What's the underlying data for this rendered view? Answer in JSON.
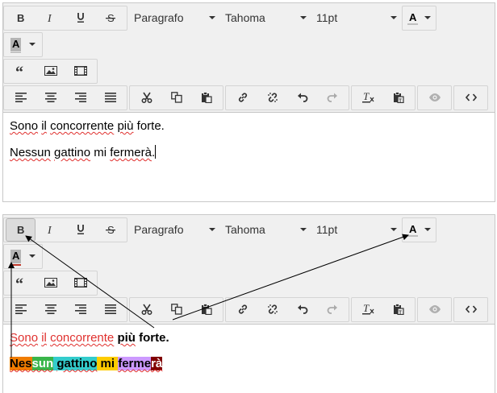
{
  "toolbar": {
    "paragraph_select": "Paragrafo",
    "font_select": "Tahoma",
    "size_select": "11pt",
    "text_color_letter": "A",
    "bg_color_letter": "A"
  },
  "editor1": {
    "line1": [
      {
        "text": "Sono",
        "sq": true
      },
      {
        "text": " "
      },
      {
        "text": "il",
        "sq": true
      },
      {
        "text": " "
      },
      {
        "text": "concorrente",
        "sq": true
      },
      {
        "text": " "
      },
      {
        "text": "più",
        "sq": true
      },
      {
        "text": " forte."
      }
    ],
    "line2": [
      {
        "text": "Nessun",
        "sq": true
      },
      {
        "text": " "
      },
      {
        "text": "gattino",
        "sq": true
      },
      {
        "text": " mi "
      },
      {
        "text": "fermerà",
        "sq": true
      },
      {
        "text": "."
      }
    ]
  },
  "editor2": {
    "line1": [
      {
        "text": "Sono",
        "color": "#e0302e",
        "sq": true
      },
      {
        "text": " ",
        "color": "#e0302e"
      },
      {
        "text": "il",
        "color": "#e0302e",
        "sq": true
      },
      {
        "text": " ",
        "color": "#e0302e"
      },
      {
        "text": "concorrente",
        "color": "#e0302e",
        "sq": true
      },
      {
        "text": " "
      },
      {
        "text": "più",
        "bold": true,
        "sq": true
      },
      {
        "text": " forte.",
        "bold": true
      }
    ],
    "line2": [
      {
        "text": "Nes",
        "bold": true,
        "bg": "#f07c00",
        "sq": true
      },
      {
        "text": "sun",
        "bold": true,
        "bg": "#39b54a",
        "color": "#ffffff",
        "sq": true
      },
      {
        "text": " ",
        "bold": true,
        "bg": "#33cccc"
      },
      {
        "text": "gattino",
        "bold": true,
        "bg": "#33cccc",
        "sq": true
      },
      {
        "text": " mi ",
        "bold": true,
        "bg": "#ffcc00"
      },
      {
        "text": "ferme",
        "bold": true,
        "bg": "#cc99ff",
        "sq": true
      },
      {
        "text": "rà",
        "bold": true,
        "bg": "#800000",
        "color": "#ffffff",
        "sq": true
      }
    ]
  },
  "colors": {
    "text_color_bar": "#ffffff",
    "bg_color_bar_top": "#ffffff",
    "bg_color_bar_bottom": "#c0392b",
    "squiggle": "#e0302e"
  }
}
